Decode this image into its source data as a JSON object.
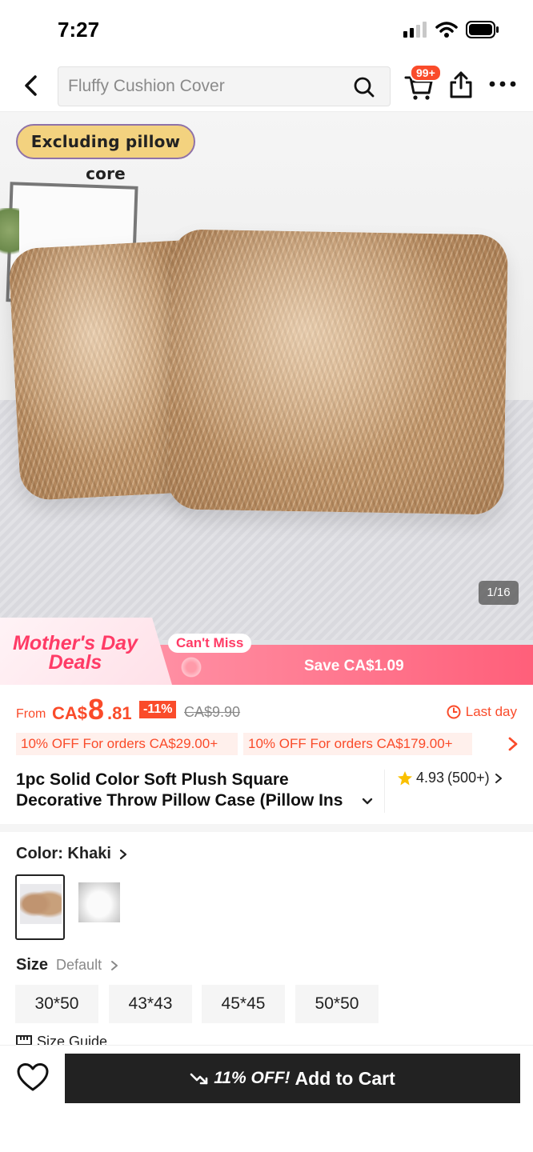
{
  "status_bar": {
    "time": "7:27"
  },
  "header": {
    "search_placeholder": "Fluffy Cushion Cover",
    "cart_badge": "99+"
  },
  "hero": {
    "overlay_label": "Excluding pillow core",
    "counter": "1/16"
  },
  "promo": {
    "event_line1": "Mother's Day",
    "event_line2": "Deals",
    "tag": "Can't Miss",
    "save_text": "Save CA$1.09"
  },
  "price": {
    "from_label": "From",
    "currency": "CA$",
    "integer": "8",
    "decimal": ".81",
    "discount": "-11%",
    "original": "CA$9.90",
    "deadline": "Last day"
  },
  "coupons": [
    "10% OFF For orders CA$29.00+",
    "10% OFF For orders CA$179.00+"
  ],
  "product": {
    "title_line1": "1pc Solid Color Soft Plush Square",
    "title_line2": "Decorative Throw Pillow Case (Pillow Ins",
    "rating": "4.93",
    "reviews": "(500+)"
  },
  "color": {
    "label": "Color: Khaki",
    "options": [
      "khaki",
      "white"
    ]
  },
  "size": {
    "label": "Size",
    "default_label": "Default",
    "options": [
      "30*50",
      "43*43",
      "45*45",
      "50*50"
    ],
    "guide": "Size Guide"
  },
  "bottom_bar": {
    "discount_text": "11% OFF!",
    "button_label": "Add to Cart"
  },
  "colors": {
    "accent": "#fa4b2a",
    "button_bg": "#222222"
  }
}
